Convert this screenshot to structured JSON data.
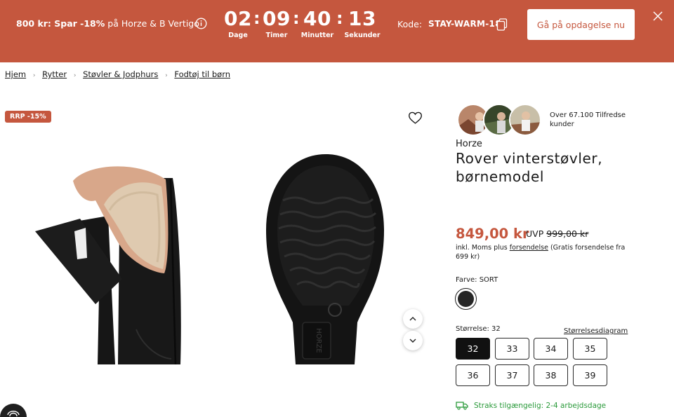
{
  "banner": {
    "promo_bold": "800 kr: Spar -18%",
    "promo_rest": " på Horze & B Vertigo",
    "countdown": [
      {
        "value": "02",
        "label": "Dage"
      },
      {
        "value": "09",
        "label": "Timer"
      },
      {
        "value": "40",
        "label": "Minutter"
      },
      {
        "value": "13",
        "label": "Sekunder"
      }
    ],
    "separator": ":",
    "code_label": "Kode:",
    "code_value": "STAY-WARM-18",
    "cta_label": "Gå på opdagelse nu",
    "background": "#c5573e"
  },
  "breadcrumb": {
    "separator": "›",
    "items": [
      "Hjem",
      "Rytter",
      "Støvler & Jodphurs",
      "Fodtøj til børn"
    ]
  },
  "gallery": {
    "badge": "RRP -15%",
    "sole_brand": "HORZE"
  },
  "product": {
    "review_text": "Over 67.100 Tilfredse kunder",
    "brand": "Horze",
    "title": "Rover vinterstøvler, børnemodel",
    "price": "849,00 kr",
    "uvp_label": "UVP",
    "uvp_value": "999,00 kr",
    "vat_prefix": "inkl. Moms plus",
    "vat_link": "forsendelse",
    "vat_suffix": "(Gratis forsendelse fra 699 kr)",
    "color_label": "Farve: SORT",
    "swatch_color": "#262626",
    "size_label": "Størrelse: 32",
    "size_chart": "Størrelsesdiagram",
    "sizes": [
      "32",
      "33",
      "34",
      "35",
      "36",
      "37",
      "38",
      "39"
    ],
    "selected_size": "32",
    "stock": "Straks tilgængelig: 2-4 arbejdsdage",
    "accent": "#c5573e",
    "stock_color": "#2a9a3a"
  }
}
